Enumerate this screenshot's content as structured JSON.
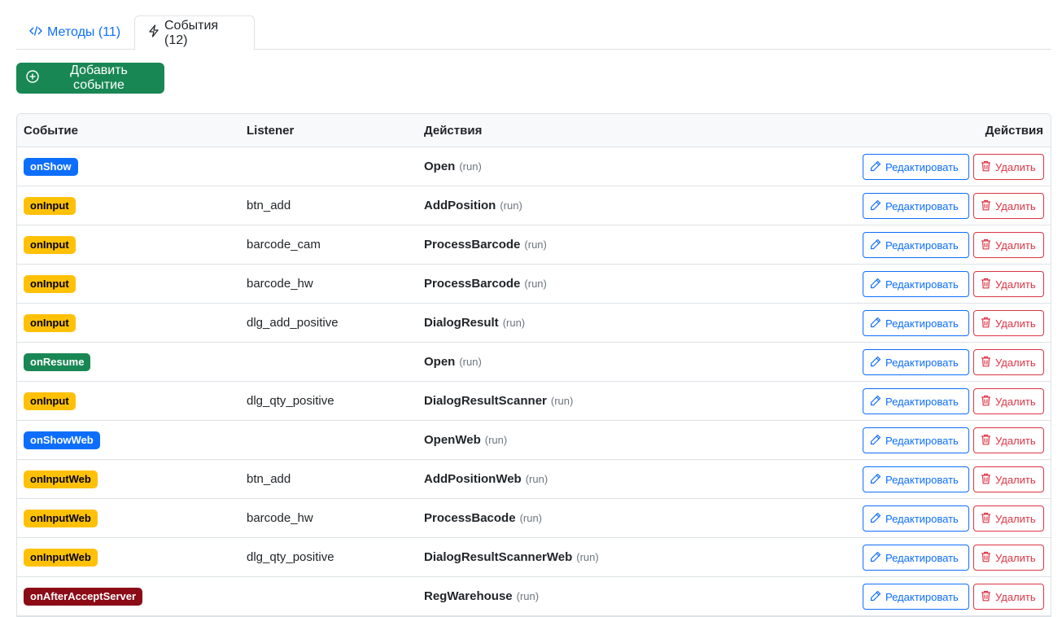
{
  "tabs": {
    "methods_label": "Методы (11)",
    "events_label": "События (12)"
  },
  "toolbar": {
    "add_event_label": "Добавить событие"
  },
  "table": {
    "headers": {
      "event": "Событие",
      "listener": "Listener",
      "actions": "Действия",
      "operations": "Действия"
    },
    "edit_label": "Редактировать",
    "delete_label": "Удалить",
    "rows": [
      {
        "event": "onShow",
        "event_style": "primary",
        "listener": "",
        "action": "Open",
        "mode": "(run)"
      },
      {
        "event": "onInput",
        "event_style": "warning",
        "listener": "btn_add",
        "action": "AddPosition",
        "mode": "(run)"
      },
      {
        "event": "onInput",
        "event_style": "warning",
        "listener": "barcode_cam",
        "action": "ProcessBarcode",
        "mode": "(run)"
      },
      {
        "event": "onInput",
        "event_style": "warning",
        "listener": "barcode_hw",
        "action": "ProcessBarcode",
        "mode": "(run)"
      },
      {
        "event": "onInput",
        "event_style": "warning",
        "listener": "dlg_add_positive",
        "action": "DialogResult",
        "mode": "(run)"
      },
      {
        "event": "onResume",
        "event_style": "success",
        "listener": "",
        "action": "Open",
        "mode": "(run)"
      },
      {
        "event": "onInput",
        "event_style": "warning",
        "listener": "dlg_qty_positive",
        "action": "DialogResultScanner",
        "mode": "(run)"
      },
      {
        "event": "onShowWeb",
        "event_style": "primary",
        "listener": "",
        "action": "OpenWeb",
        "mode": "(run)"
      },
      {
        "event": "onInputWeb",
        "event_style": "warning",
        "listener": "btn_add",
        "action": "AddPositionWeb",
        "mode": "(run)"
      },
      {
        "event": "onInputWeb",
        "event_style": "warning",
        "listener": "barcode_hw",
        "action": "ProcessBacode",
        "mode": "(run)"
      },
      {
        "event": "onInputWeb",
        "event_style": "warning",
        "listener": "dlg_qty_positive",
        "action": "DialogResultScannerWeb",
        "mode": "(run)"
      },
      {
        "event": "onAfterAcceptServer",
        "event_style": "danger",
        "listener": "",
        "action": "RegWarehouse",
        "mode": "(run)"
      }
    ]
  },
  "colors": {
    "primary": "#0d6efd",
    "warning": "#ffc107",
    "success": "#198754",
    "danger": "#dc3545"
  },
  "icons": {
    "methods_tab": "code-icon",
    "events_tab": "lightning-icon",
    "add": "plus-circle-icon",
    "edit": "pencil-icon",
    "delete": "trash-icon"
  }
}
